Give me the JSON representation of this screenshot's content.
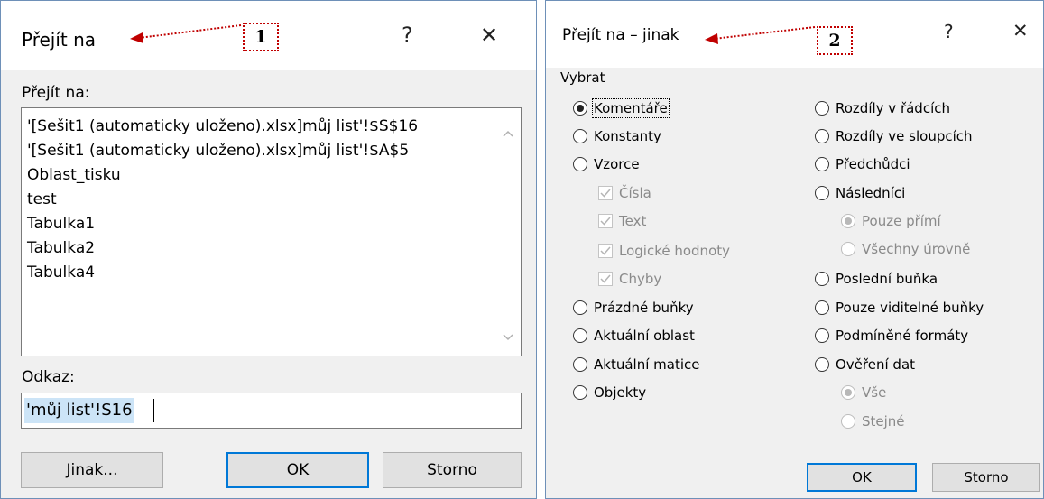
{
  "dialog1": {
    "title": "Přejít na",
    "help": "?",
    "close": "✕",
    "callout": "1",
    "goto_label": "Přejít na:",
    "list_items": [
      "'[Sešit1 (automaticky uloženo).xlsx]můj list'!$S$16",
      "'[Sešit1 (automaticky uloženo).xlsx]můj list'!$A$5",
      "Oblast_tisku",
      "test",
      "Tabulka1",
      "Tabulka2",
      "Tabulka4"
    ],
    "reference_label": "Odkaz:",
    "reference_value": "'můj list'!S16",
    "special_button": "Jinak...",
    "ok_button": "OK",
    "cancel_button": "Storno"
  },
  "dialog2": {
    "title": "Přejít na – jinak",
    "help": "?",
    "close": "✕",
    "callout": "2",
    "group_label": "Vybrat",
    "left_options": {
      "comments": "Komentáře",
      "constants": "Konstanty",
      "formulas": "Vzorce",
      "numbers": "Čísla",
      "text": "Text",
      "logicals": "Logické hodnoty",
      "errors": "Chyby",
      "blanks": "Prázdné buňky",
      "current_region": "Aktuální oblast",
      "current_array": "Aktuální matice",
      "objects": "Objekty"
    },
    "right_options": {
      "row_differences": "Rozdíly v řádcích",
      "column_differences": "Rozdíly ve sloupcích",
      "precedents": "Předchůdci",
      "dependents": "Následníci",
      "direct_only": "Pouze přímí",
      "all_levels": "Všechny úrovně",
      "last_cell": "Poslední buňka",
      "visible_cells": "Pouze viditelné buňky",
      "conditional_formats": "Podmíněné formáty",
      "data_validation": "Ověření dat",
      "all": "Vše",
      "same": "Stejné"
    },
    "ok_button": "OK",
    "cancel_button": "Storno"
  },
  "colors": {
    "accent": "#0078d7",
    "callout_red": "#c00000",
    "selection": "#cce4f7",
    "dialog_bg": "#f0f0f0"
  }
}
